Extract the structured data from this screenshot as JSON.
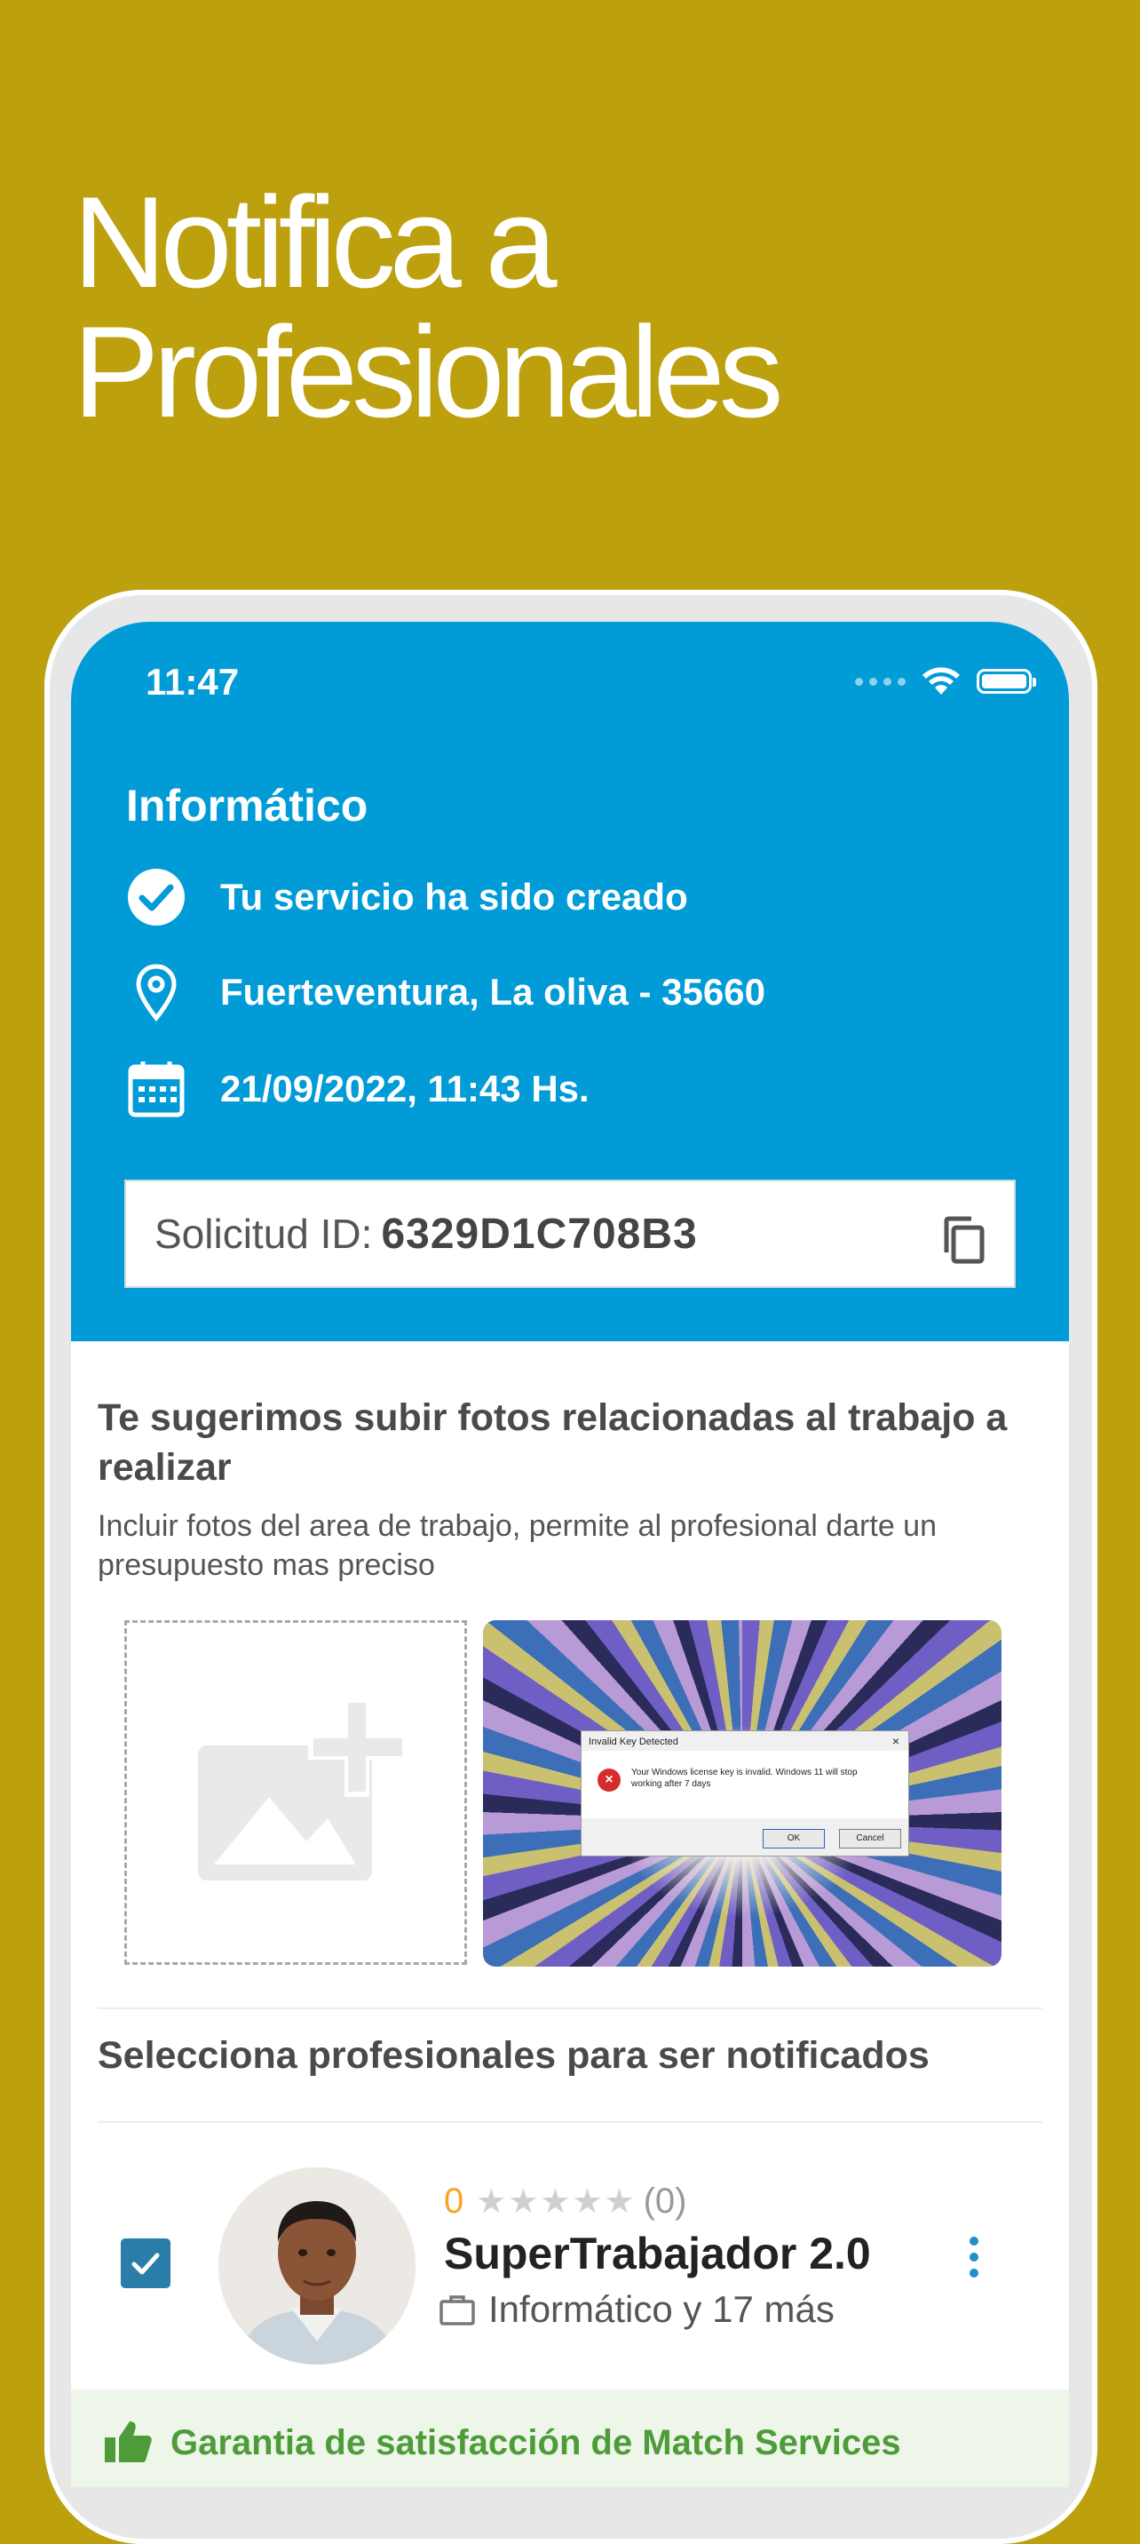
{
  "promo": {
    "headline_line1": "Notifica a",
    "headline_line2": "Profesionales"
  },
  "status_bar": {
    "time": "11:47"
  },
  "service": {
    "title": "Informático",
    "created_text": "Tu servicio ha sido creado",
    "location": "Fuerteventura, La oliva - 35660",
    "datetime": "21/09/2022, 11:43 Hs.",
    "request_id_label": "Solicitud ID:",
    "request_id_value": "6329D1C708B3"
  },
  "photos_section": {
    "title": "Te sugerimos subir fotos relacionadas al trabajo a realizar",
    "description": "Incluir fotos del area de trabajo, permite al profesional darte un presupuesto mas preciso",
    "photo_dialog": {
      "title": "Invalid Key Detected",
      "message": "Your Windows license key is invalid. Windows 11 will stop working after 7 days",
      "ok": "OK",
      "cancel": "Cancel"
    }
  },
  "professionals_section": {
    "title": "Selecciona profesionales para ser notificados",
    "items": [
      {
        "checked": true,
        "rating_value": "0",
        "stars": "★★★★★",
        "rating_count": "(0)",
        "name": "SuperTrabajador 2.0",
        "categories": "Informático y 17 más"
      }
    ]
  },
  "guarantee": {
    "text": "Garantia de satisfacción de Match Services"
  },
  "colors": {
    "background": "#BCA00E",
    "header_blue": "#019BD7",
    "checkbox": "#2A7DA8",
    "rating": "#F5A623",
    "guarantee_green": "#4E9C39"
  }
}
